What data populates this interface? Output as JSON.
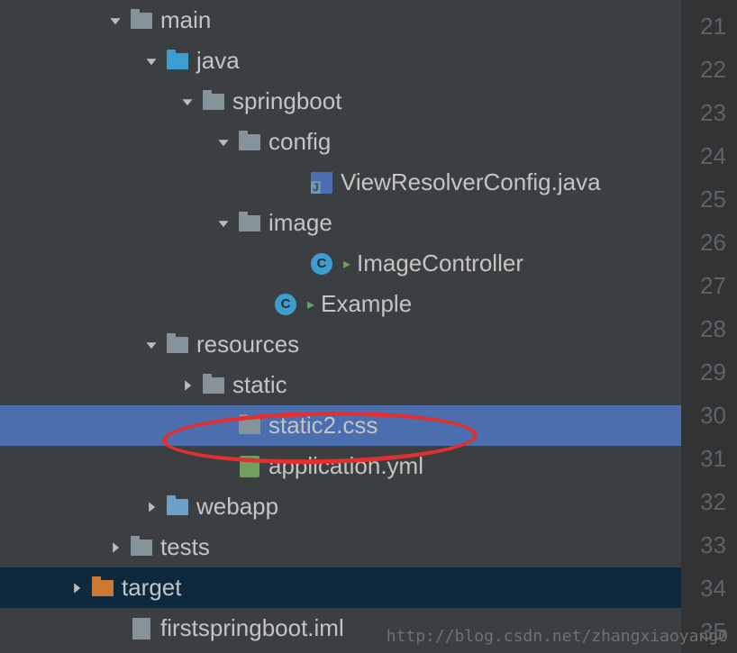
{
  "tree": {
    "items": [
      {
        "label": "main",
        "indent": 1,
        "expanded": true,
        "iconType": "folder",
        "hasArrow": true
      },
      {
        "label": "java",
        "indent": 2,
        "expanded": true,
        "iconType": "java-folder",
        "hasArrow": true
      },
      {
        "label": "springboot",
        "indent": 3,
        "expanded": true,
        "iconType": "package-folder",
        "hasArrow": true
      },
      {
        "label": "config",
        "indent": 4,
        "expanded": true,
        "iconType": "package-folder",
        "hasArrow": true
      },
      {
        "label": "ViewResolverConfig.java",
        "indent": 6,
        "expanded": false,
        "iconType": "java-file",
        "hasArrow": false
      },
      {
        "label": "image",
        "indent": 4,
        "expanded": true,
        "iconType": "package-folder",
        "hasArrow": true
      },
      {
        "label": "ImageController",
        "indent": 6,
        "expanded": false,
        "iconType": "class-blue",
        "hasArrow": false,
        "runnable": true
      },
      {
        "label": "Example",
        "indent": 5,
        "expanded": false,
        "iconType": "class-blue-run",
        "hasArrow": false,
        "runnable": true
      },
      {
        "label": "resources",
        "indent": 2,
        "expanded": true,
        "iconType": "resources-folder",
        "hasArrow": true
      },
      {
        "label": "static",
        "indent": 3,
        "expanded": false,
        "iconType": "package-folder",
        "hasArrow": true,
        "arrowRight": true
      },
      {
        "label": "static2.css",
        "indent": 4,
        "expanded": false,
        "iconType": "package-folder",
        "hasArrow": false,
        "selected": true
      },
      {
        "label": "application.yml",
        "indent": 4,
        "expanded": false,
        "iconType": "yaml-file",
        "hasArrow": false
      },
      {
        "label": "webapp",
        "indent": 2,
        "expanded": false,
        "iconType": "webapp-folder",
        "hasArrow": true,
        "arrowRight": true
      },
      {
        "label": "tests",
        "indent": 1,
        "expanded": false,
        "iconType": "folder",
        "hasArrow": true,
        "arrowRight": true
      },
      {
        "label": "target",
        "indent": 0,
        "expanded": false,
        "iconType": "target-folder",
        "hasArrow": true,
        "arrowRight": true,
        "cursor": true
      },
      {
        "label": "firstspringboot.iml",
        "indent": 1,
        "expanded": false,
        "iconType": "iml-file",
        "hasArrow": false
      }
    ]
  },
  "gutter": {
    "start": 21,
    "end": 35
  },
  "watermark": "http://blog.csdn.net/zhangxiaoyang0"
}
